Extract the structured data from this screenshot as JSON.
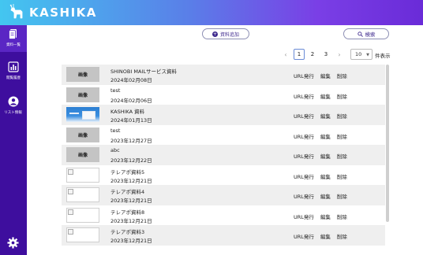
{
  "app": {
    "brand": "KASHIKA"
  },
  "sidebar": {
    "items": [
      {
        "label": "資料一覧",
        "icon": "document-icon"
      },
      {
        "label": "閲覧履歴",
        "icon": "bar-chart-icon"
      },
      {
        "label": "リスト情報",
        "icon": "user-icon"
      }
    ],
    "settings_icon": "gear-icon"
  },
  "toolbar": {
    "add_label": "資料追加",
    "search_label": "検索"
  },
  "pagination": {
    "prev": "‹",
    "pages": [
      "1",
      "2",
      "3"
    ],
    "current": "1",
    "next": "›"
  },
  "per_page": {
    "value": "10",
    "suffix": "件表示"
  },
  "table": {
    "image_label": "画像",
    "action_url": "URL発行",
    "action_edit": "編集",
    "action_delete": "削除",
    "rows": [
      {
        "title": "SHINOBI MAILサービス資料",
        "date": "2024年02月08日",
        "thumb": "gray"
      },
      {
        "title": "test",
        "date": "2024年02月06日",
        "thumb": "gray"
      },
      {
        "title": "KASHIKA 資料",
        "date": "2024年01月13日",
        "thumb": "shot"
      },
      {
        "title": "test",
        "date": "2023年12月27日",
        "thumb": "gray"
      },
      {
        "title": "abc",
        "date": "2023年12月22日",
        "thumb": "gray"
      },
      {
        "title": "テレアポ資料5",
        "date": "2023年12月21日",
        "thumb": "blank"
      },
      {
        "title": "テレアポ資料4",
        "date": "2023年12月21日",
        "thumb": "blank"
      },
      {
        "title": "テレアポ資料8",
        "date": "2023年12月21日",
        "thumb": "blank"
      },
      {
        "title": "テレアポ資料3",
        "date": "2023年12月21日",
        "thumb": "blank"
      }
    ]
  }
}
